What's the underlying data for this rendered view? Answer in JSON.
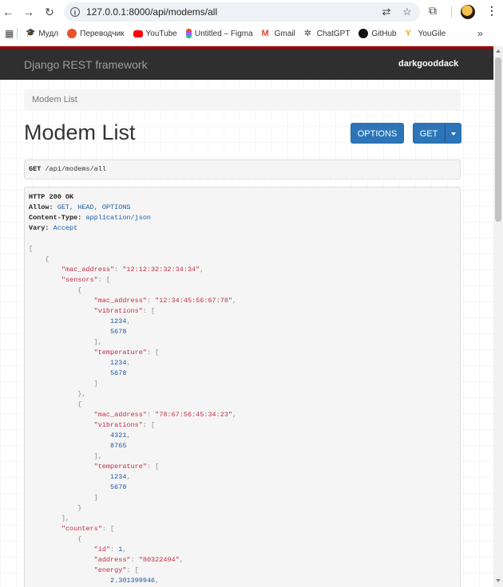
{
  "browser": {
    "url": "127.0.0.1:8000/api/modems/all",
    "bookmarks": [
      {
        "label": "Мудл",
        "icon": "graduation-cap-icon",
        "color": "#333333"
      },
      {
        "label": "Переводчик",
        "icon": "translate-icon",
        "color": "#e8532a"
      },
      {
        "label": "YouTube",
        "icon": "youtube-icon",
        "color": "#ff0000"
      },
      {
        "label": "Untitled – Figma",
        "icon": "figma-icon",
        "color": "#f24e1e"
      },
      {
        "label": "Gmail",
        "icon": "gmail-icon",
        "color": "#ea4335"
      },
      {
        "label": "ChatGPT",
        "icon": "chatgpt-icon",
        "color": "#444444"
      },
      {
        "label": "GitHub",
        "icon": "github-icon",
        "color": "#111111"
      },
      {
        "label": "YouGile",
        "icon": "yougile-icon",
        "color": "#f5a623"
      }
    ],
    "more_label": "»"
  },
  "navbar": {
    "brand": "Django REST framework",
    "user": "darkgooddack",
    "accent": "#a30000"
  },
  "breadcrumb": "Modem List",
  "page_title": "Modem List",
  "buttons": {
    "options": "OPTIONS",
    "get": "GET",
    "color": "#2c75b8"
  },
  "request": {
    "method": "GET",
    "path": "/api/modems/all"
  },
  "response": {
    "status": "HTTP 200 OK",
    "headers": [
      {
        "name": "Allow:",
        "value": "GET, HEAD, OPTIONS"
      },
      {
        "name": "Content-Type:",
        "value": "application/json"
      },
      {
        "name": "Vary:",
        "value": "Accept"
      }
    ],
    "body": {
      "modems": [
        {
          "mac_address": "12:12:32:32:34:34",
          "sensors": [
            {
              "mac_address": "12:34:45:56:67:78",
              "vibrations": [
                "1234",
                "5678"
              ],
              "temperature": [
                "1234",
                "5678"
              ]
            },
            {
              "mac_address": "78:67:56:45:34:23",
              "vibrations": [
                "4321",
                "8765"
              ],
              "temperature": [
                "1234",
                "5678"
              ]
            }
          ],
          "counters": [
            {
              "id": "1",
              "address": "80322494",
              "energy": [
                "2.301399946"
              ]
            }
          ]
        }
      ]
    }
  }
}
